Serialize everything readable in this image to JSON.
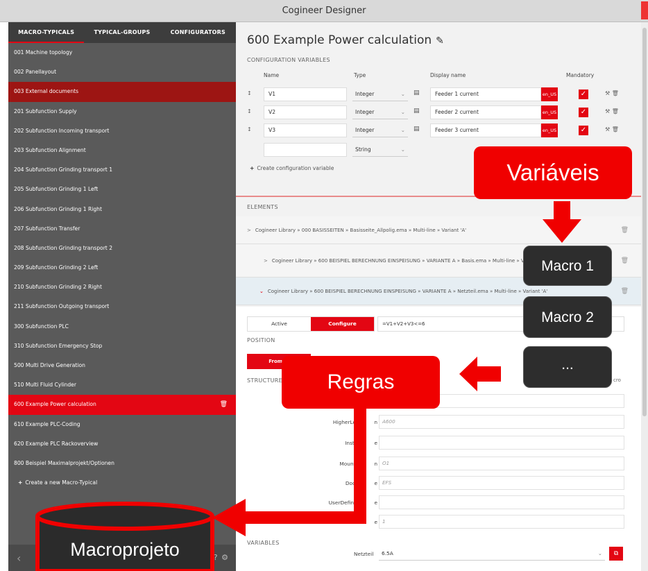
{
  "window": {
    "title": "Cogineer Designer"
  },
  "sidebar": {
    "tabs": [
      "MACRO-TYPICALS",
      "TYPICAL-GROUPS",
      "CONFIGURATORS"
    ],
    "items": [
      "001 Machine topology",
      "002 Panellayout",
      "003 External documents",
      "201 Subfunction Supply",
      "202 Subfunction Incoming transport",
      "203 Subfunction Alignment",
      "204 Subfunction Grinding transport 1",
      "205 Subfunction Grinding 1 Left",
      "206 Subfunction Grinding 1 Right",
      "207 Subfunction Transfer",
      "208 Subfunction Grinding transport 2",
      "209 Subfunction Grinding 2 Left",
      "210 Subfunction Grinding 2 Right",
      "211 Subfunction Outgoing transport",
      "300 Subfunction PLC",
      "310 Subfunction Emergency Stop",
      "500 Multi Drive Generation",
      "510 Multi Fluid Cylinder",
      "600 Example Power calculation",
      "610 Example PLC-Coding",
      "620 Example PLC Rackoverview",
      "800 Beispiel Maximalprojekt/Optionen"
    ],
    "create_label": "Create a new Macro-Typical"
  },
  "main": {
    "title": "600 Example Power calculation",
    "config_section": "CONFIGURATION VARIABLES",
    "columns": {
      "name": "Name",
      "type": "Type",
      "display": "Display name",
      "mandatory": "Mandatory"
    },
    "variables": [
      {
        "name": "V1",
        "type": "Integer",
        "display": "Feeder 1 current",
        "lang": "en_US"
      },
      {
        "name": "V2",
        "type": "Integer",
        "display": "Feeder 2 current",
        "lang": "en_US"
      },
      {
        "name": "V3",
        "type": "Integer",
        "display": "Feeder 3 current",
        "lang": "en_US"
      }
    ],
    "new_var_type": "String",
    "create_var_label": "Create configuration variable",
    "elements_section": "ELEMENTS",
    "elements": [
      "Cogineer Library » 000 BASISSEITEN » Basisseite_Allpolig.ema » Multi-line » Variant 'A'",
      "Cogineer Library » 600 BEISPIEL BERECHNUNG EINSPEISUNG » VARIANTE A » Basis.ema » Multi-line » Variant 'A'",
      "Cogineer Library » 600 BEISPIEL BERECHNUNG EINSPEISUNG » VARIANTE A » Netzteil.ema » Multi-line » Variant 'A'"
    ],
    "segment": {
      "active": "Active",
      "configure": "Configure"
    },
    "rule": "=V1+V2+V3<=6",
    "position_section": "POSITION",
    "position_button": "From m",
    "structure_section": "STRUCTURE",
    "structure_extra": "cro",
    "structure_fields": [
      {
        "label": "",
        "value": ""
      },
      {
        "label": "HigherLevel",
        "suffix": "n",
        "value": "A600"
      },
      {
        "label": "Installa",
        "suffix": "e",
        "value": ""
      },
      {
        "label": "Mounting",
        "suffix": "n",
        "value": "O1"
      },
      {
        "label": "Docum",
        "suffix": "e",
        "value": "EFS"
      },
      {
        "label": "UserDefinedS",
        "suffix": "e",
        "value": ""
      },
      {
        "label": "Pa",
        "suffix": "e",
        "value": "1"
      }
    ],
    "variables_section": "VARIABLES",
    "netzteil_label": "Netzteil",
    "netzteil_value": "6.5A"
  },
  "annotations": {
    "variaveis": "Variáveis",
    "macro1": "Macro 1",
    "macro2": "Macro 2",
    "more": "...",
    "regras": "Regras",
    "macroprojeto": "Macroprojeto"
  },
  "colors": {
    "brand_red": "#e30613",
    "sidebar": "#5a5a5a",
    "annotation_red": "#f00000"
  }
}
